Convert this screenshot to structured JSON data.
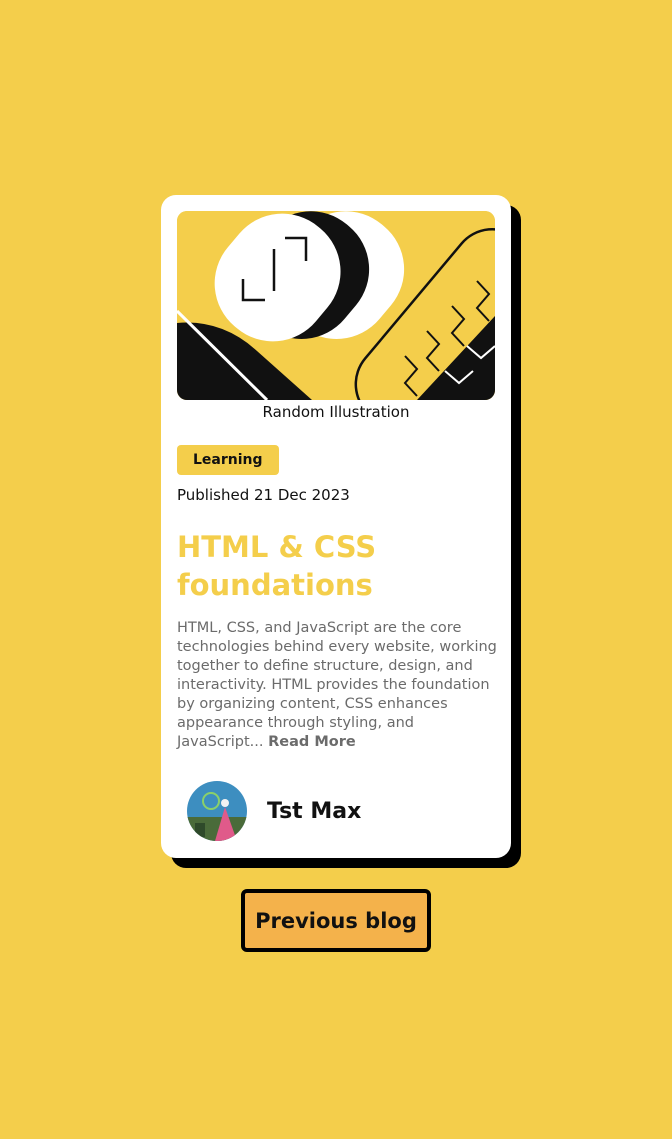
{
  "card": {
    "image_caption": "Random Illustration",
    "category": "Learning",
    "published": "Published 21 Dec 2023",
    "title": "HTML & CSS foundations",
    "excerpt": "HTML, CSS, and JavaScript are the core technologies behind every website, working together to define structure, design, and interactivity. HTML provides the foundation by organizing content, CSS enhances appearance through styling, and JavaScript...",
    "read_more": "Read More",
    "author": "Tst Max"
  },
  "previous_button": "Previous blog",
  "colors": {
    "background": "#f4ce4b",
    "accent": "#f4ce4b",
    "button": "#f4b24b",
    "shadow": "#000000"
  }
}
